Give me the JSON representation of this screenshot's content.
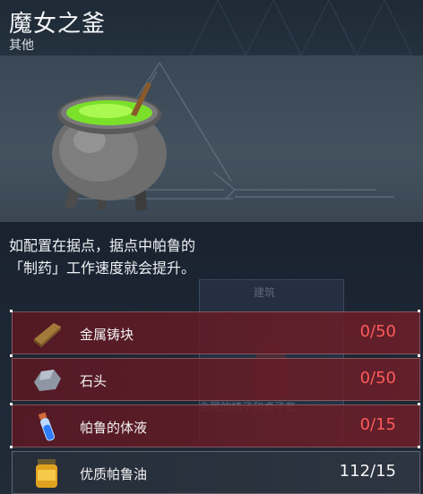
{
  "header": {
    "title": "魔女之釜",
    "subtitle": "其他"
  },
  "description": {
    "line1": "如配置在据点，据点中帕鲁的",
    "line2": "「制药」工作速度就会提升。"
  },
  "background_overlay": {
    "label_top": "建筑",
    "label_bottom": "金属的椅子和桌子套"
  },
  "materials": [
    {
      "name": "金属铸块",
      "count": "0/50",
      "status": "insufficient",
      "icon": "metal-ingot-icon"
    },
    {
      "name": "石头",
      "count": "0/50",
      "status": "insufficient",
      "icon": "stone-icon"
    },
    {
      "name": "帕鲁的体液",
      "count": "0/15",
      "status": "insufficient",
      "icon": "pal-fluid-vial-icon"
    },
    {
      "name": "优质帕鲁油",
      "count": "112/15",
      "status": "sufficient",
      "icon": "high-quality-pal-oil-jar-icon"
    }
  ],
  "colors": {
    "insufficient": "#ff5a5a",
    "sufficient": "#f4f4f4",
    "potion_green": "#7be02a"
  }
}
